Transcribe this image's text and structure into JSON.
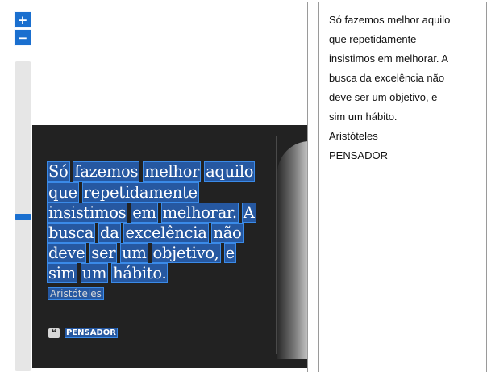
{
  "viewer": {
    "zoom_in_label": "+",
    "zoom_out_label": "−",
    "zoom_level": 0.5,
    "image": {
      "quote_lines": [
        [
          "Só",
          "fazemos",
          "melhor",
          "aquilo"
        ],
        [
          "que",
          "repetidamente"
        ],
        [
          "insistimos",
          "em",
          "melhorar.",
          "A"
        ],
        [
          "busca",
          "da",
          "excelência",
          "não"
        ],
        [
          "deve",
          "ser",
          "um",
          "objetivo,",
          "e"
        ],
        [
          "sim",
          "um",
          "hábito."
        ]
      ],
      "author": "Aristóteles",
      "brand_icon": "quote-icon",
      "brand_icon_glyph": "❝",
      "brand": "PENSADOR"
    }
  },
  "extracted_text": {
    "lines": [
      "Só fazemos melhor aquilo",
      "que repetidamente",
      "insistimos em melhorar. A",
      "busca da excelência não",
      "deve ser um objetivo, e",
      "sim um hábito.",
      "Aristóteles",
      "PENSADOR"
    ]
  },
  "colors": {
    "accent": "#1a6fcf",
    "image_background": "#222222",
    "highlight": "#3a8ae8"
  }
}
